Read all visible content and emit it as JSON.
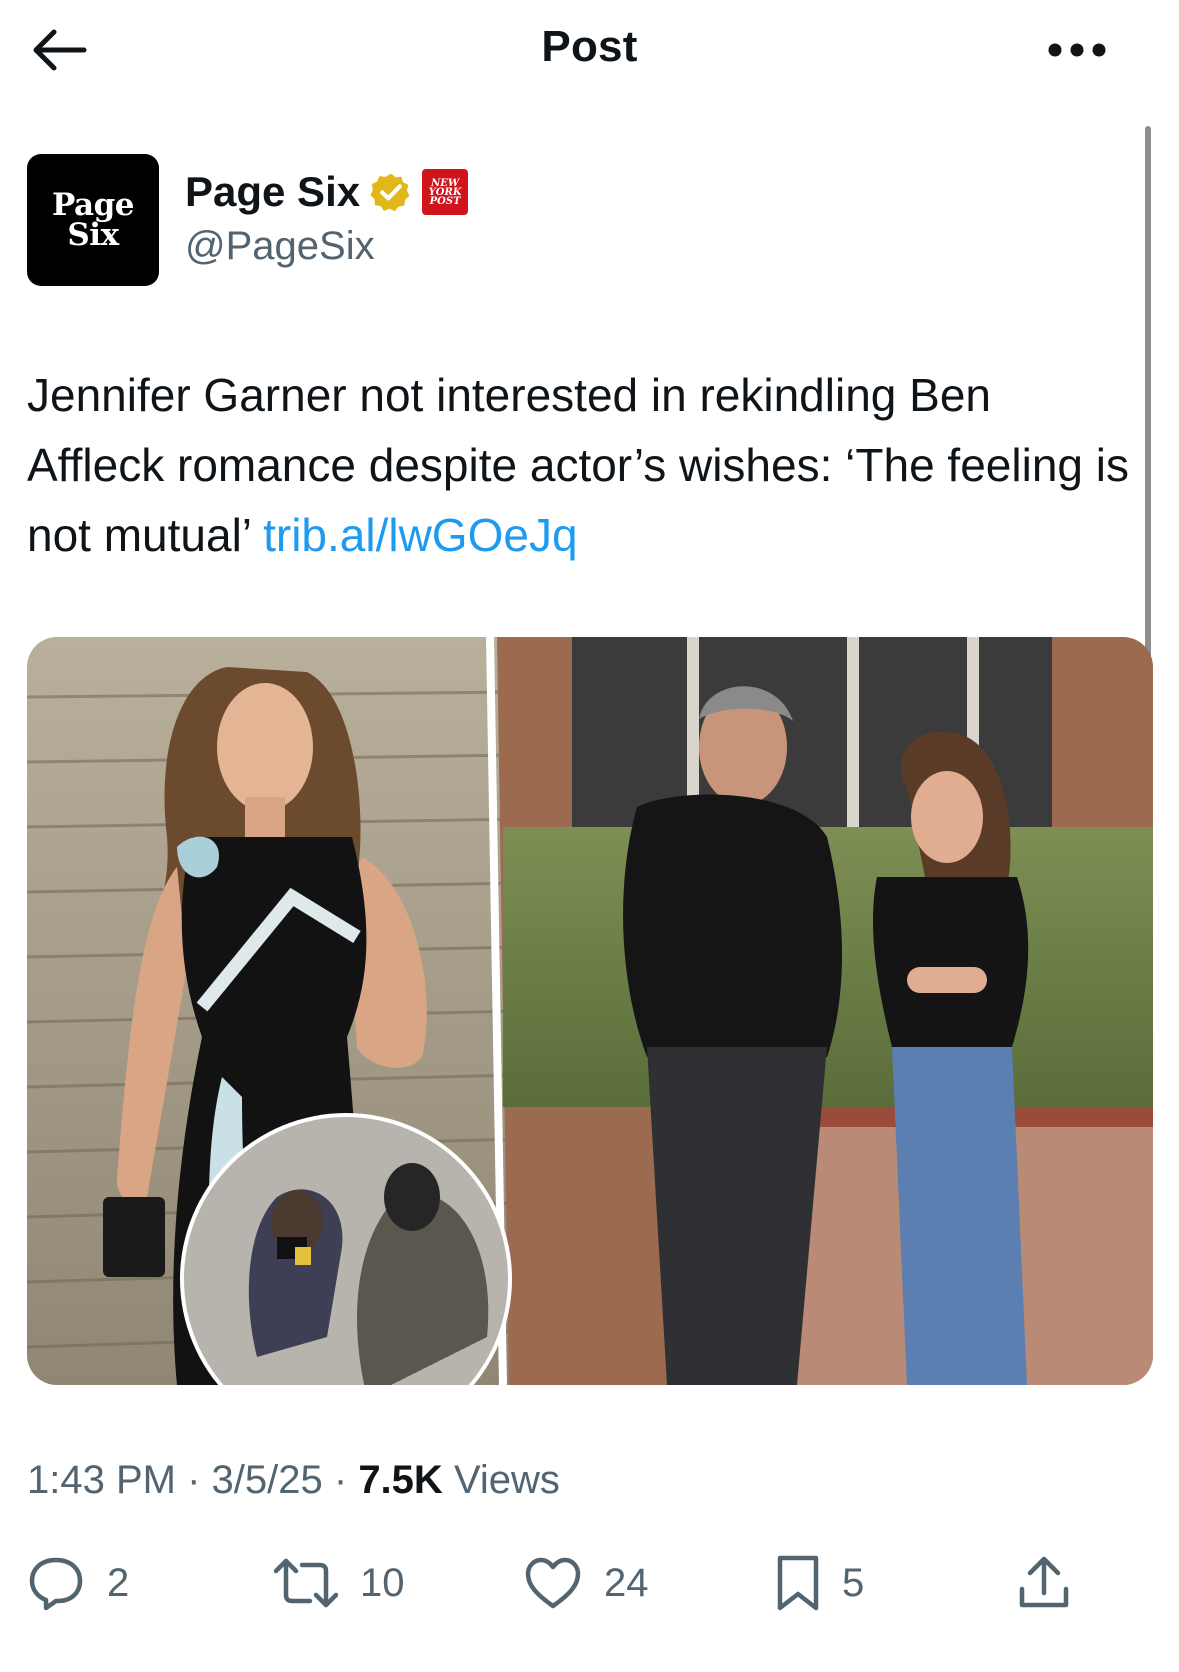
{
  "header": {
    "title": "Post",
    "back_icon": "arrow-left-icon",
    "more_icon": "more-horizontal-icon"
  },
  "author": {
    "avatar_text_line1": "Page",
    "avatar_text_line2": "Six",
    "display_name": "Page Six",
    "handle": "@PageSix",
    "verified_color": "#e2b719",
    "affiliate_badge_lines": [
      "NEW",
      "YORK",
      "POST"
    ],
    "affiliate_badge_color": "#d0141c"
  },
  "tweet": {
    "text": "Jennifer Garner not interested in rekindling Ben Affleck romance despite actor’s wishes: ‘The feeling is not mutual’ ",
    "link": "trib.al/lwGOeJq",
    "link_color": "#1d9bf0"
  },
  "meta": {
    "time": "1:43 PM",
    "date": "3/5/25",
    "views_count": "7.5K",
    "views_label": "Views"
  },
  "actions": {
    "replies": "2",
    "reposts": "10",
    "likes": "24",
    "bookmarks": "5"
  },
  "colors": {
    "text_primary": "#0f1419",
    "text_secondary": "#536471"
  }
}
